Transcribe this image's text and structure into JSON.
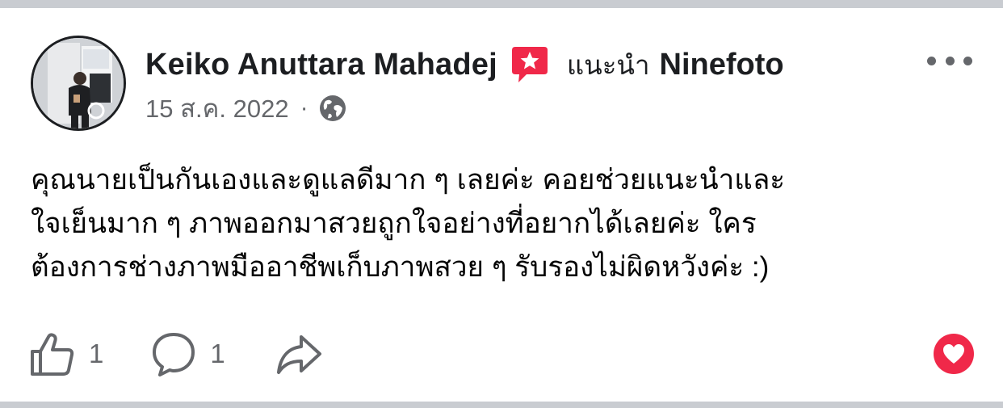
{
  "post": {
    "author_name": "Keiko Anuttara Mahadej",
    "recommend_word": "แนะนำ",
    "recommended_page": "Ninefoto",
    "date": "15 ส.ค. 2022",
    "meta_separator": "·",
    "privacy_icon": "globe-icon",
    "text_lines": [
      "คุณนายเป็นกันเองและดูแลดีมาก ๆ เลยค่ะ คอยช่วยแนะนำและ",
      "ใจเย็นมาก ๆ ภาพออกมาสวยถูกใจอย่างที่อยากได้เลยค่ะ ใคร",
      "ต้องการช่างภาพมืออาชีพเก็บภาพสวย ๆ รับรองไม่ผิดหวังค่ะ :)"
    ]
  },
  "actions": {
    "like_count": "1",
    "comment_count": "1"
  },
  "colors": {
    "badge": "#f02849",
    "reaction_heart": "#f02849",
    "secondary_text": "#65676b",
    "divider": "#c9ccd1"
  }
}
